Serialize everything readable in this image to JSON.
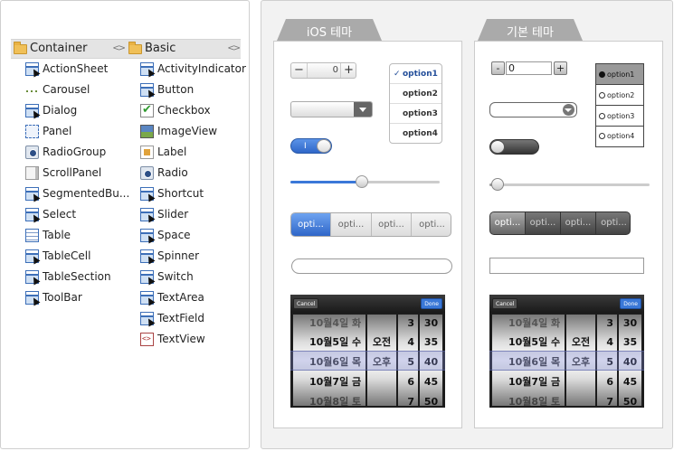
{
  "palette": {
    "categories": [
      {
        "name": "Container",
        "items": [
          "ActionSheet",
          "Carousel",
          "Dialog",
          "Panel",
          "RadioGroup",
          "ScrollPanel",
          "SegmentedBu...",
          "Select",
          "Table",
          "TableCell",
          "TableSection",
          "ToolBar"
        ]
      },
      {
        "name": "Basic",
        "items": [
          "ActivityIndicator",
          "Button",
          "Checkbox",
          "ImageView",
          "Label",
          "Radio",
          "Shortcut",
          "Slider",
          "Space",
          "Spinner",
          "Switch",
          "TextArea",
          "TextField",
          "TextView"
        ]
      }
    ],
    "collapse_glyph": "<>"
  },
  "themes": [
    {
      "tab": "iOS 테마",
      "stepper": {
        "minus": "−",
        "plus": "+",
        "value": "0"
      },
      "options": [
        "option1",
        "option2",
        "option3",
        "option4"
      ],
      "selected_option": "option1",
      "check_mark": "✓",
      "switch_state": "I",
      "slider_value": 0.48,
      "segments": [
        "opti...",
        "opti...",
        "opti...",
        "opti..."
      ],
      "picker": {
        "cancel": "Cancel",
        "done": "Done"
      }
    },
    {
      "tab": "기본 테마",
      "stepper": {
        "minus": "-",
        "plus": "+",
        "value": "0"
      },
      "options": [
        "option1",
        "option2",
        "option3",
        "option4"
      ],
      "selected_option": "option1",
      "slider_value": 0.05,
      "segments": [
        "opti...",
        "opti...",
        "opti...",
        "opti..."
      ],
      "picker": {
        "cancel": "Cancel",
        "done": "Done"
      }
    }
  ],
  "picker_rows": {
    "dates": [
      "10월4일 화",
      "10월5일 수",
      "10월6일 목",
      "10월7일 금",
      "10월8일 토"
    ],
    "ampm": [
      "",
      "오전",
      "오후",
      "",
      ""
    ],
    "hours": [
      "3",
      "4",
      "5",
      "6",
      "7"
    ],
    "minutes": [
      "30",
      "35",
      "40",
      "45",
      "50"
    ]
  },
  "colors": {
    "ios_blue": "#3a78d8",
    "tab_gray": "#aaaaaa",
    "dark_segment": "#555555"
  }
}
